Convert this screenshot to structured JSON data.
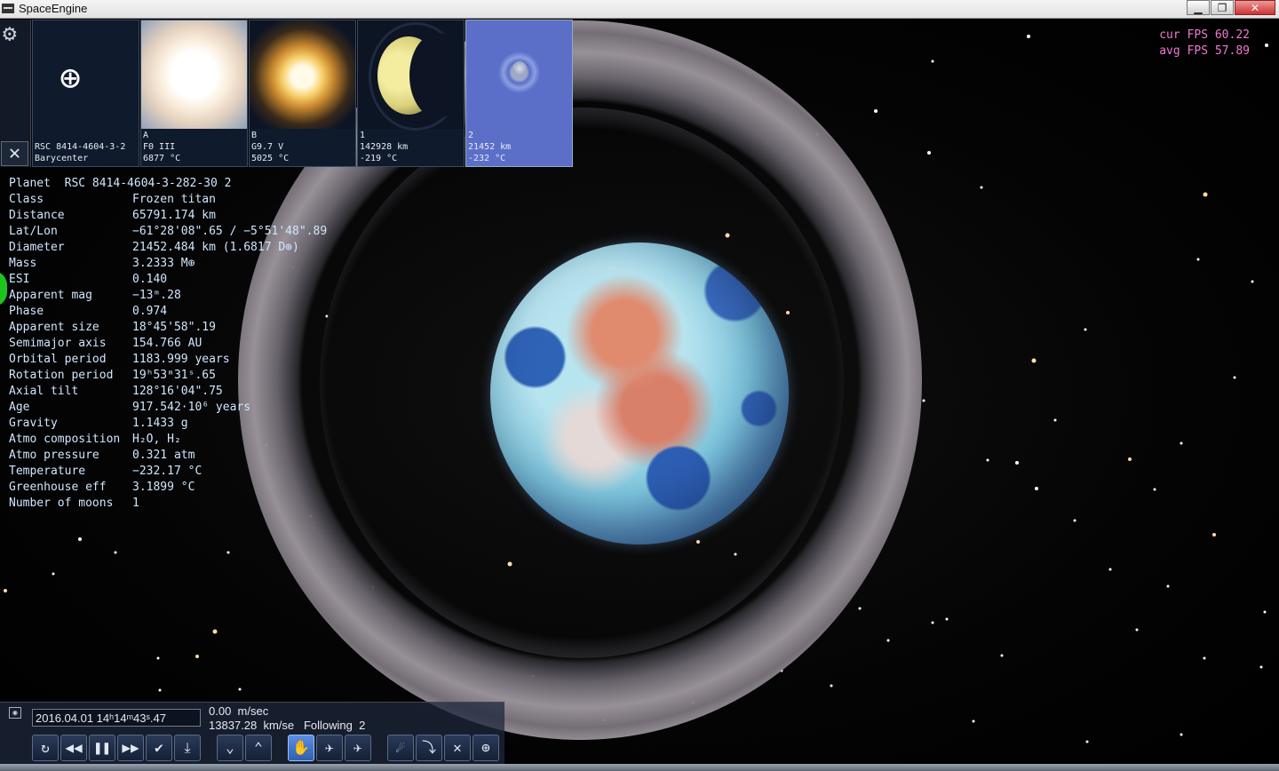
{
  "window": {
    "title": "SpaceEngine",
    "minimize": "▁",
    "maximize": "❐",
    "close": "✕"
  },
  "fps": {
    "cur_label": "cur FPS",
    "cur_value": "60.22",
    "avg_label": "avg FPS",
    "avg_value": "57.89"
  },
  "thumbs": [
    {
      "line1": "RSC 8414-4604-3-2",
      "line2": "Barycenter",
      "line3": ""
    },
    {
      "line1": "A",
      "line2": "F0 III",
      "line3": "6877 °C"
    },
    {
      "line1": "B",
      "line2": "G9.7 V",
      "line3": "5025 °C"
    },
    {
      "line1": "1",
      "line2": "142928 km",
      "line3": "-219 °C"
    },
    {
      "line1": "2",
      "line2": "21452 km",
      "line3": "-232 °C"
    }
  ],
  "info": {
    "header": "Planet  RSC 8414-4604-3-282-30 2",
    "rows": [
      {
        "k": "Class",
        "v": "Frozen titan"
      },
      {
        "k": "Distance",
        "v": "65791.174 km"
      },
      {
        "k": "Lat/Lon",
        "v": "−61°28'08\".65 / −5°51'48\".89"
      },
      {
        "k": "Diameter",
        "v": "21452.484 km (1.6817 D⊕)"
      },
      {
        "k": "Mass",
        "v": "3.2333 M⊕"
      },
      {
        "k": "ESI",
        "v": "0.140"
      },
      {
        "k": "Apparent mag",
        "v": "−13ᵐ.28"
      },
      {
        "k": "Phase",
        "v": "0.974"
      },
      {
        "k": "Apparent size",
        "v": "18°45'58\".19"
      },
      {
        "k": "Semimajor axis",
        "v": "154.766 AU"
      },
      {
        "k": "Orbital period",
        "v": "1183.999 years"
      },
      {
        "k": "Rotation period",
        "v": "19ʰ53ᵐ31ˢ.65"
      },
      {
        "k": "Axial tilt",
        "v": "128°16'04\".75"
      },
      {
        "k": "Age",
        "v": "917.542·10⁶ years"
      },
      {
        "k": "Gravity",
        "v": "1.1433 g"
      },
      {
        "k": "Atmo composition",
        "v": "H₂O, H₂"
      },
      {
        "k": "Atmo pressure",
        "v": "0.321 atm"
      },
      {
        "k": "Temperature",
        "v": "−232.17 °C"
      },
      {
        "k": "Greenhouse eff",
        "v": "3.1899 °C"
      },
      {
        "k": "Number of moons",
        "v": "1"
      }
    ]
  },
  "controls": {
    "date": "2016.04.01 14ʰ14ᵐ43ˢ.47",
    "velocity": "0.00  m/sec",
    "speed": "13837.28  km/se",
    "following": "Following  2",
    "buttons": [
      "↻",
      "◀◀",
      "❚❚",
      "▶▶",
      "✔",
      "⤓",
      "⌄",
      "⌃",
      "✋",
      "✈",
      "✈",
      "☄",
      "⤵",
      "✕",
      "⊕"
    ]
  },
  "colors": {
    "fps": "#f07ad0",
    "info_text": "#cfe6ff",
    "selected_thumb": "#5b6fc9"
  }
}
